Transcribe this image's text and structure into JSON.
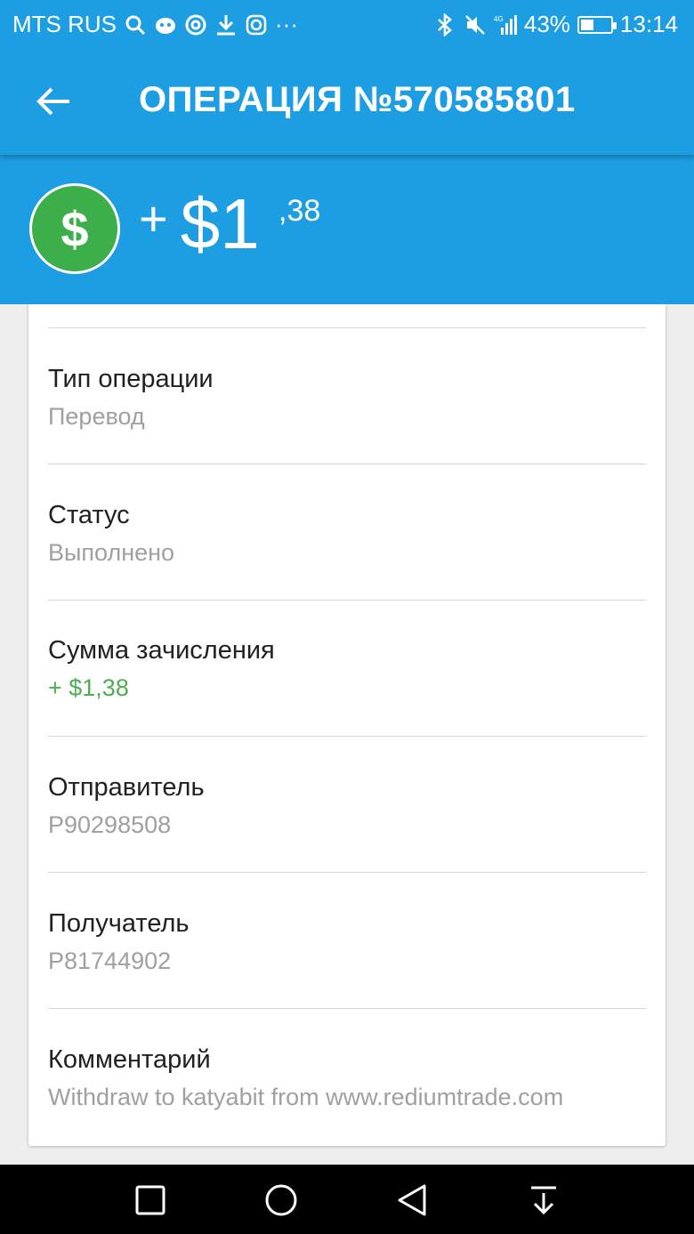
{
  "status_bar": {
    "carrier": "MTS RUS",
    "dots": "···",
    "network": "4G",
    "battery": "43%",
    "battery_level": 0.43,
    "time": "13:14"
  },
  "app_bar": {
    "title": "ОПЕРАЦИЯ №570585801",
    "back_icon": "arrow-back-icon"
  },
  "amount": {
    "icon": "dollar-icon",
    "icon_symbol": "$",
    "sign": "+",
    "whole": "$1",
    "cents": ",38",
    "accent_color": "#1e9ee2",
    "icon_color": "#3cae4a"
  },
  "details": [
    {
      "label": "Тип операции",
      "value": "Перевод"
    },
    {
      "label": "Статус",
      "value": "Выполнено"
    },
    {
      "label": "Сумма зачисления",
      "value": "+ $1,38",
      "value_color": "#4caf50"
    },
    {
      "label": "Отправитель",
      "value": "P90298508"
    },
    {
      "label": "Получатель",
      "value": "P81744902"
    },
    {
      "label": "Комментарий",
      "value": "Withdraw to katyabit from www.rediumtrade.com"
    }
  ],
  "nav_bar": {
    "buttons": [
      "recent-apps-icon",
      "home-icon",
      "back-icon",
      "notification-pull-icon"
    ]
  }
}
